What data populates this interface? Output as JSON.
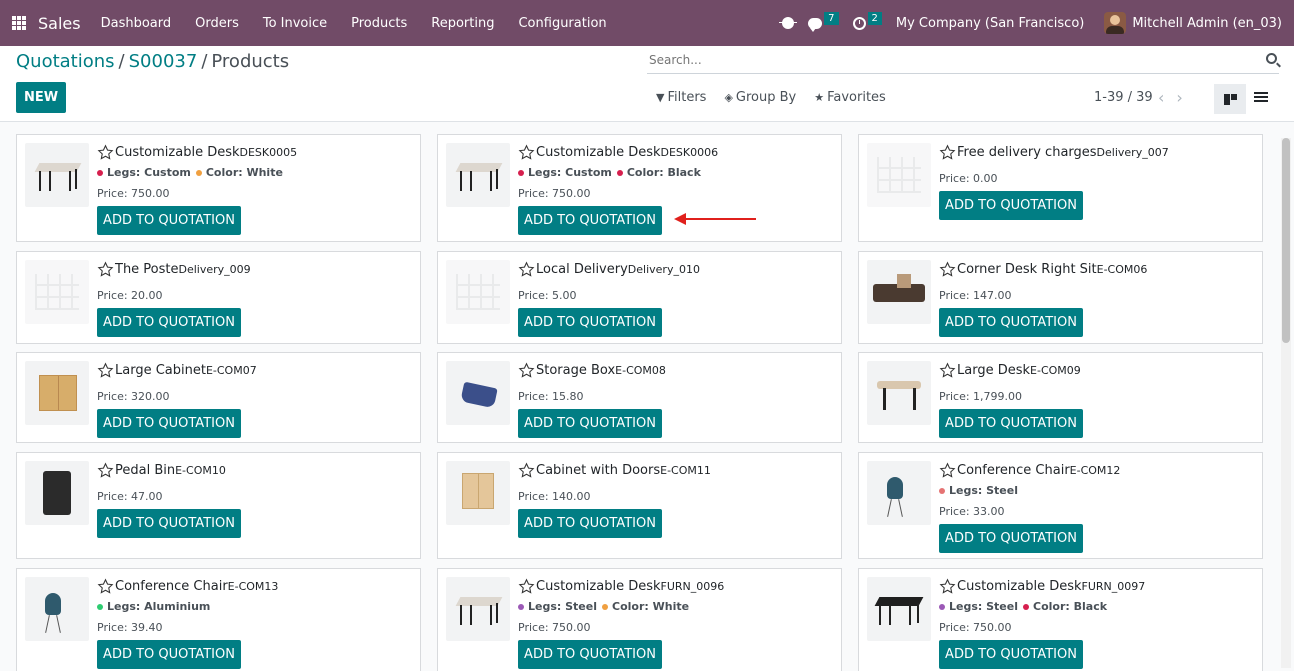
{
  "navbar": {
    "app_name": "Sales",
    "menu": [
      "Dashboard",
      "Orders",
      "To Invoice",
      "Products",
      "Reporting",
      "Configuration"
    ],
    "messages_count": "7",
    "activities_count": "2",
    "company": "My Company (San Francisco)",
    "user": "Mitchell Admin (en_03)"
  },
  "breadcrumb": {
    "root": "Quotations",
    "order": "S00037",
    "current": "Products"
  },
  "control": {
    "new_label": "NEW",
    "search_placeholder": "Search...",
    "filters_label": "Filters",
    "groupby_label": "Group By",
    "favorites_label": "Favorites",
    "pager": "1-39 / 39"
  },
  "add_label": "ADD TO QUOTATION",
  "colors": {
    "primary": "#017E84",
    "navbar": "#714B67",
    "arrow": "#e0201c"
  },
  "products": [
    {
      "name": "Customizable Desk",
      "code": "DESK0005",
      "attrs": [
        {
          "label": "Legs: Custom",
          "color": "#d61f4e"
        },
        {
          "label": "Color: White",
          "color": "#f0a040"
        }
      ],
      "price": "Price: 750.00",
      "icon": "desk-white-icon"
    },
    {
      "name": "Customizable Desk",
      "code": "DESK0006",
      "attrs": [
        {
          "label": "Legs: Custom",
          "color": "#d61f4e"
        },
        {
          "label": "Color: Black",
          "color": "#d61f4e"
        }
      ],
      "price": "Price: 750.00",
      "icon": "desk-white-icon"
    },
    {
      "name": "Free delivery charges",
      "code": "Delivery_007",
      "attrs": [],
      "price": "Price: 0.00",
      "icon": "placeholder-image-icon"
    },
    {
      "name": "The Poste",
      "code": "Delivery_009",
      "attrs": [],
      "price": "Price: 20.00",
      "icon": "placeholder-image-icon"
    },
    {
      "name": "Local Delivery",
      "code": "Delivery_010",
      "attrs": [],
      "price": "Price: 5.00",
      "icon": "placeholder-image-icon"
    },
    {
      "name": "Corner Desk Right Sit",
      "code": "E-COM06",
      "attrs": [],
      "price": "Price: 147.00",
      "icon": "corner-desk-icon"
    },
    {
      "name": "Large Cabinet",
      "code": "E-COM07",
      "attrs": [],
      "price": "Price: 320.00",
      "icon": "cabinet-icon"
    },
    {
      "name": "Storage Box",
      "code": "E-COM08",
      "attrs": [],
      "price": "Price: 15.80",
      "icon": "storage-box-icon"
    },
    {
      "name": "Large Desk",
      "code": "E-COM09",
      "attrs": [],
      "price": "Price: 1,799.00",
      "icon": "large-desk-icon"
    },
    {
      "name": "Pedal Bin",
      "code": "E-COM10",
      "attrs": [],
      "price": "Price: 47.00",
      "icon": "pedal-bin-icon"
    },
    {
      "name": "Cabinet with Doors",
      "code": "E-COM11",
      "attrs": [],
      "price": "Price: 140.00",
      "icon": "cabinet-doors-icon"
    },
    {
      "name": "Conference Chair",
      "code": "E-COM12",
      "attrs": [
        {
          "label": "Legs: Steel",
          "color": "#e57373"
        }
      ],
      "price": "Price: 33.00",
      "icon": "chair-icon"
    },
    {
      "name": "Conference Chair",
      "code": "E-COM13",
      "attrs": [
        {
          "label": "Legs: Aluminium",
          "color": "#2ecc71"
        }
      ],
      "price": "Price: 39.40",
      "icon": "chair-icon"
    },
    {
      "name": "Customizable Desk",
      "code": "FURN_0096",
      "attrs": [
        {
          "label": "Legs: Steel",
          "color": "#9b59b6"
        },
        {
          "label": "Color: White",
          "color": "#f0a040"
        }
      ],
      "price": "Price: 750.00",
      "icon": "desk-white-icon"
    },
    {
      "name": "Customizable Desk",
      "code": "FURN_0097",
      "attrs": [
        {
          "label": "Legs: Steel",
          "color": "#9b59b6"
        },
        {
          "label": "Color: Black",
          "color": "#d61f4e"
        }
      ],
      "price": "Price: 750.00",
      "icon": "desk-black-icon"
    }
  ]
}
